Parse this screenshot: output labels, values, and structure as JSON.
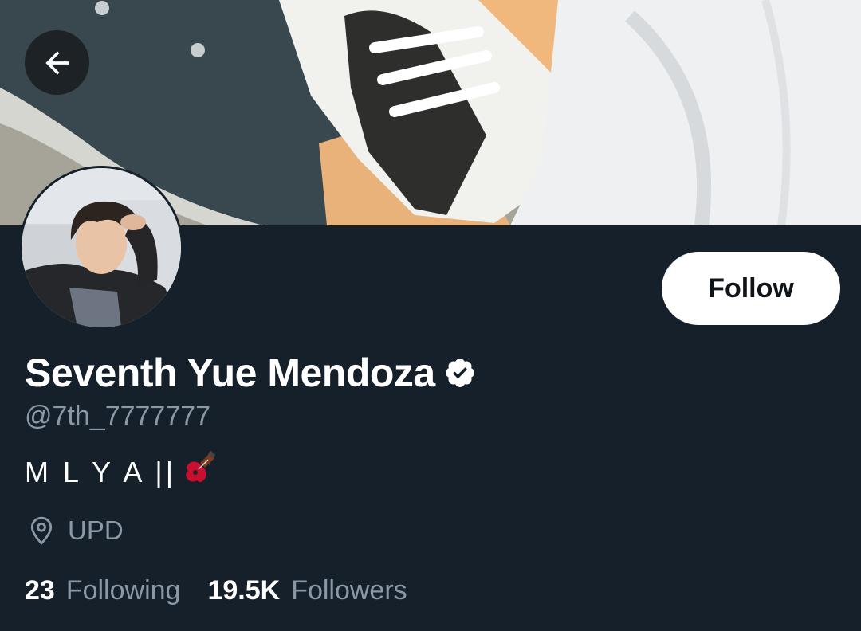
{
  "profile": {
    "display_name": "Seventh Yue Mendoza",
    "handle": "@7th_7777777",
    "bio": "M L Y A ||",
    "bio_emoji": "guitar-emoji",
    "location": "UPD",
    "verified": true
  },
  "actions": {
    "follow_label": "Follow",
    "back_icon": "back-arrow-icon"
  },
  "stats": {
    "following_count": "23",
    "following_label": "Following",
    "followers_count": "19.5K",
    "followers_label": "Followers"
  },
  "colors": {
    "background": "#15202b",
    "text_primary": "#ffffff",
    "text_secondary": "#8b98a5",
    "button_bg": "#ffffff",
    "button_text": "#0f1419"
  }
}
